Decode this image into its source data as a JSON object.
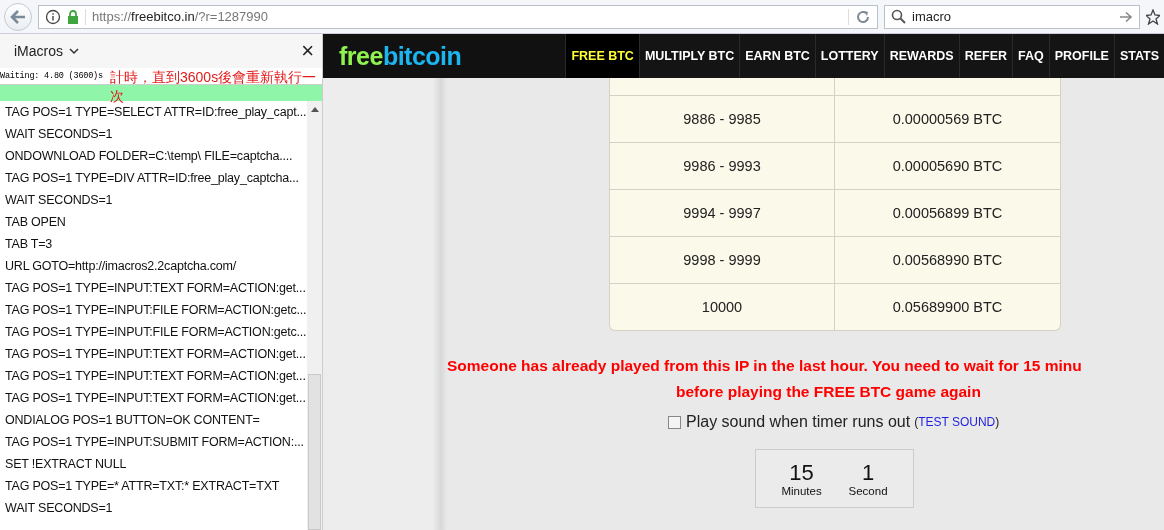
{
  "browser": {
    "url": {
      "scheme": "https://",
      "host": "freebitco.in",
      "path": "/?r=1287990"
    },
    "search": {
      "value": "imacro"
    }
  },
  "sidebar": {
    "title": "iMacros",
    "close": "×",
    "status": "Waiting: 4.80 (3600)s",
    "annotation": "計時，直到3600s後會重新執行一次",
    "progress": {
      "level": 1
    },
    "lines": [
      "TAG POS=1 TYPE=SELECT ATTR=ID:free_play_capt...",
      "WAIT SECONDS=1",
      "ONDOWNLOAD FOLDER=C:\\temp\\ FILE=captcha....",
      "TAG POS=1 TYPE=DIV ATTR=ID:free_play_captcha...",
      "WAIT SECONDS=1",
      "TAB OPEN",
      "TAB T=3",
      "URL GOTO=http://imacros2.2captcha.com/",
      "TAG POS=1 TYPE=INPUT:TEXT FORM=ACTION:get...",
      "TAG POS=1 TYPE=INPUT:FILE FORM=ACTION:getc...",
      "TAG POS=1 TYPE=INPUT:FILE FORM=ACTION:getc...",
      "TAG POS=1 TYPE=INPUT:TEXT FORM=ACTION:get...",
      "TAG POS=1 TYPE=INPUT:TEXT FORM=ACTION:get...",
      "TAG POS=1 TYPE=INPUT:TEXT FORM=ACTION:get...",
      "ONDIALOG POS=1 BUTTON=OK CONTENT=",
      "TAG POS=1 TYPE=INPUT:SUBMIT FORM=ACTION:...",
      "SET !EXTRACT NULL",
      "TAG POS=1 TYPE=* ATTR=TXT:* EXTRACT=TXT",
      "WAIT SECONDS=1"
    ]
  },
  "site": {
    "logo": {
      "first": "free",
      "second": "bitcoin"
    },
    "nav": [
      {
        "label": "FREE BTC",
        "selected": true
      },
      {
        "label": "MULTIPLY BTC",
        "selected": false
      },
      {
        "label": "EARN BTC",
        "selected": false
      },
      {
        "label": "LOTTERY",
        "selected": false
      },
      {
        "label": "REWARDS",
        "selected": false
      },
      {
        "label": "REFER",
        "selected": false
      },
      {
        "label": "FAQ",
        "selected": false
      },
      {
        "label": "PROFILE",
        "selected": false
      },
      {
        "label": "STATS",
        "selected": false
      }
    ],
    "payout_table": {
      "rows": [
        [
          "9886 - 9985",
          "0.00000569 BTC"
        ],
        [
          "9986 - 9993",
          "0.00005690 BTC"
        ],
        [
          "9994 - 9997",
          "0.00056899 BTC"
        ],
        [
          "9998 - 9999",
          "0.00568990 BTC"
        ],
        [
          "10000",
          "0.05689900 BTC"
        ]
      ]
    },
    "message": [
      "Someone has already played from this IP in the last hour. You need to wait for 15 minu",
      "before playing the FREE BTC game again"
    ],
    "sound_alert": {
      "label": "Play sound when timer runs out",
      "checked": false,
      "open": "(",
      "link": "TEST SOUND",
      "close": ")"
    },
    "timer": [
      {
        "value": "15",
        "unit": "Minutes"
      },
      {
        "value": "1",
        "unit": "Second"
      }
    ]
  }
}
